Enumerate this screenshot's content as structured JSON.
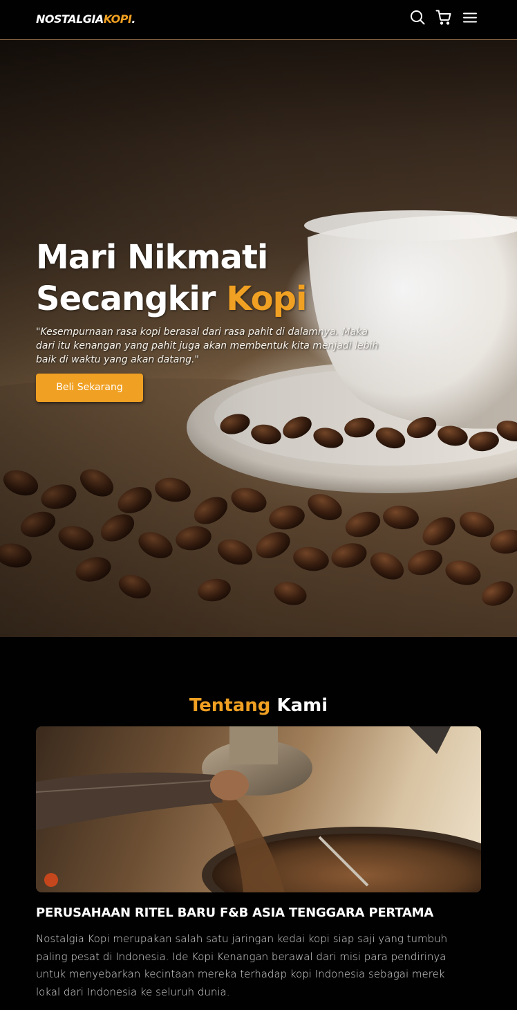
{
  "navbar": {
    "logo_main": "NOSTALGIA",
    "logo_accent": "KOPI",
    "logo_dot": ".",
    "icons": [
      "search-icon",
      "shopping-cart-icon",
      "menu-icon"
    ]
  },
  "hero": {
    "title_line1": "Mari Nikmati",
    "title_line2_prefix": "Secangkir ",
    "title_line2_accent": "Kopi",
    "quote": "\"Kesempurnaan rasa kopi berasal dari rasa pahit di dalamnya. Maka dari itu kenangan yang pahit juga akan membentuk kita menjadi lebih baik di waktu yang akan datang.\"",
    "cta_label": "Beli Sekarang"
  },
  "about": {
    "title_accent": "Tentang",
    "title_rest": " Kami",
    "heading": "PERUSAHAAN RITEL BARU F&B ASIA TENGGARA PERTAMA",
    "paragraph": "Nostalgia Kopi merupakan salah satu jaringan kedai kopi siap saji yang tumbuh paling pesat di Indonesia. Ide Kopi Kenangan berawal dari misi para pendirinya untuk menyebarkan kecintaan mereka terhadap kopi Indonesia sebagai merek lokal dari Indonesia ke seluruh dunia."
  },
  "colors": {
    "accent": "#f0a022",
    "background": "#010101",
    "text": "#ffffff",
    "nav_border": "#b6895b"
  }
}
